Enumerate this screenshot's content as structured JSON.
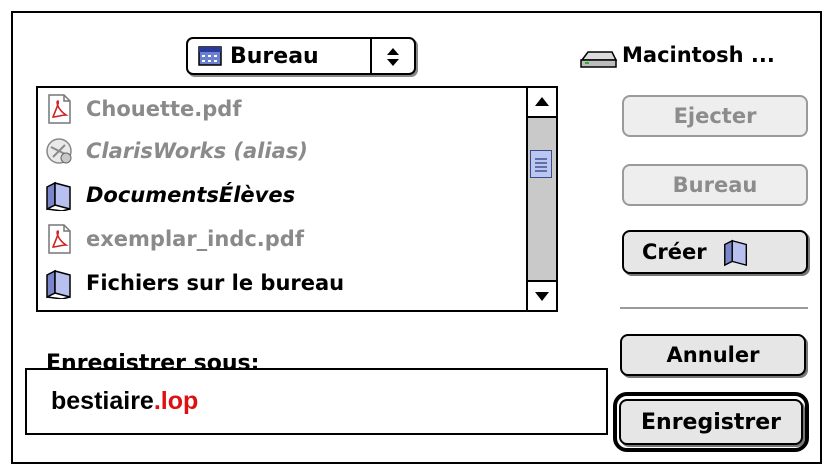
{
  "dialog": {
    "location_popup": {
      "label": "Bureau",
      "icon": "desktop-icon"
    },
    "volume": {
      "label": "Macintosh ...",
      "icon": "hard-disk-icon"
    },
    "files": [
      {
        "name": "Chouette.pdf",
        "icon": "pdf-document-icon",
        "style": "dim"
      },
      {
        "name": "ClarisWorks (alias)",
        "icon": "application-alias-icon",
        "style": "dim-italic"
      },
      {
        "name": "DocumentsÉlèves",
        "icon": "folder-icon",
        "style": "italic"
      },
      {
        "name": "exemplar_indc.pdf",
        "icon": "pdf-document-icon",
        "style": "dim"
      },
      {
        "name": "Fichiers sur le bureau",
        "icon": "folder-icon",
        "style": "normal"
      }
    ],
    "buttons": {
      "eject": "Ejecter",
      "desktop": "Bureau",
      "new_folder": "Créer",
      "cancel": "Annuler",
      "save": "Enregistrer"
    },
    "save_as_label": "Enregistrer sous:",
    "filename": {
      "base": "bestiaire",
      "extension": ".lop"
    },
    "colors": {
      "extension": "#e01010",
      "scroll_thumb": "#b9c7f1",
      "scroll_track": "#c9c9c9"
    }
  }
}
